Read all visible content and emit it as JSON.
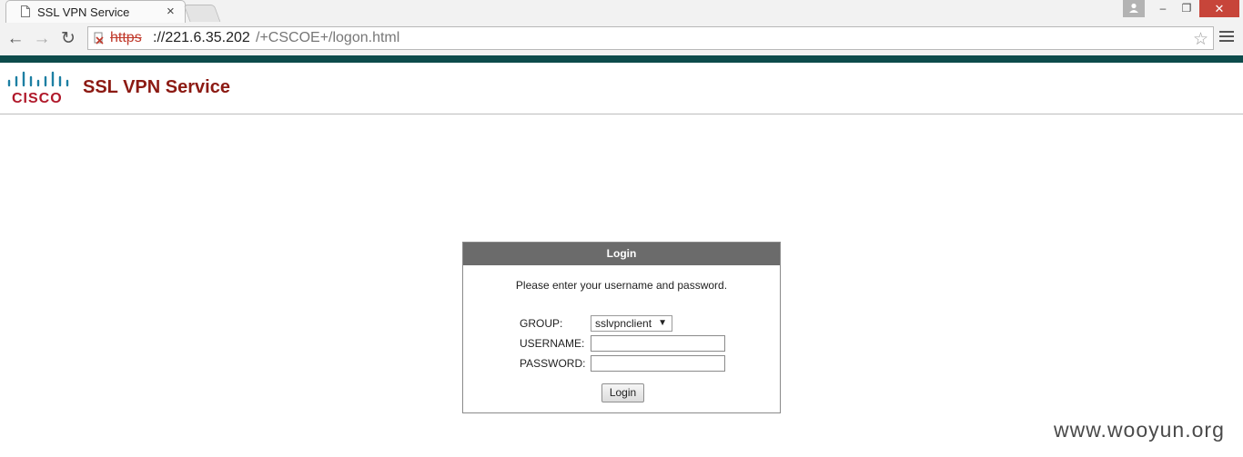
{
  "browser": {
    "tab": {
      "title": "SSL VPN Service",
      "close_glyph": "×"
    },
    "window_controls": {
      "minimize": "–",
      "restore": "❐",
      "close": "✕"
    },
    "nav": {
      "back": "←",
      "forward": "→",
      "reload": "↻"
    },
    "address_bar": {
      "scheme": "https",
      "host": "://221.6.35.202",
      "path": "/+CSCOE+/logon.html",
      "star": "☆"
    }
  },
  "page": {
    "logo_text": "CISCO",
    "title": "SSL VPN Service",
    "login": {
      "header": "Login",
      "prompt": "Please enter your username and password.",
      "group_label": "GROUP:",
      "group_value": "sslvpnclient",
      "username_label": "USERNAME:",
      "password_label": "PASSWORD:",
      "username_value": "",
      "password_value": "",
      "button": "Login"
    },
    "watermark": "www.wooyun.org"
  },
  "colors": {
    "topbar": "#0d4b4b",
    "title": "#8c1a13",
    "cisco_red": "#b0182a",
    "login_header": "#6b6b6b"
  },
  "icons": [
    "page-icon",
    "back-arrow-icon",
    "forward-arrow-icon",
    "reload-icon",
    "insecure-lock-icon",
    "bookmark-star-icon",
    "menu-icon",
    "user-icon"
  ]
}
